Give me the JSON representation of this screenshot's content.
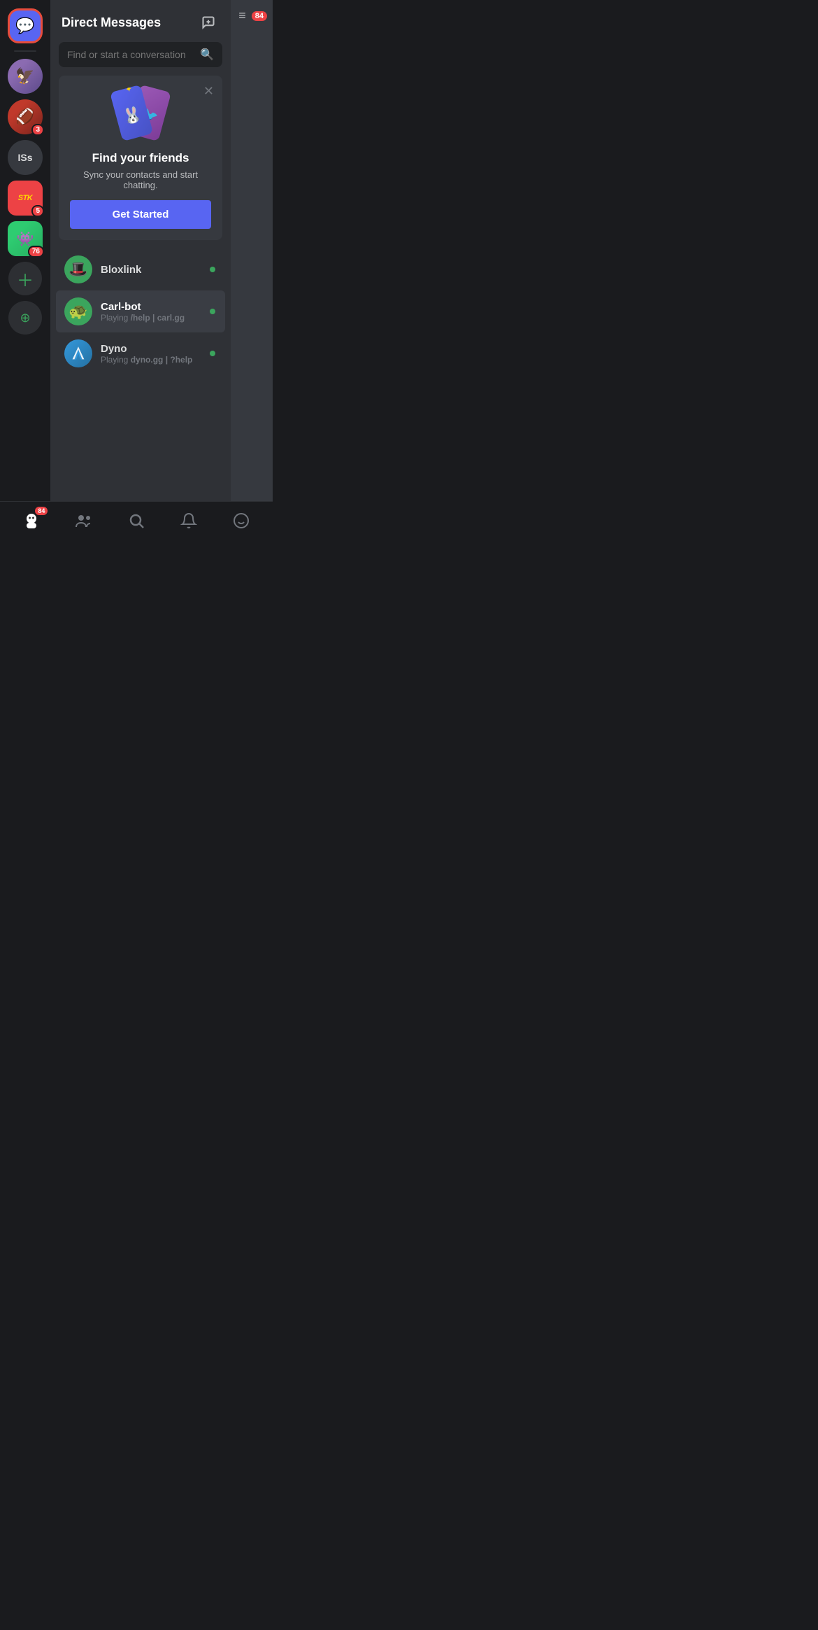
{
  "header": {
    "title": "Direct Messages",
    "new_dm_icon": "➕"
  },
  "search": {
    "placeholder": "Find or start a conversation"
  },
  "find_friends": {
    "title": "Find your friends",
    "subtitle": "Sync your contacts and start chatting.",
    "button_label": "Get Started"
  },
  "dm_list": [
    {
      "id": "bloxlink",
      "name": "Bloxlink",
      "status": "",
      "avatar_emoji": "🎩",
      "online": true,
      "active": false
    },
    {
      "id": "carl-bot",
      "name": "Carl-bot",
      "status_prefix": "Playing ",
      "status_bold": "/help | carl.gg",
      "avatar_emoji": "🐢",
      "online": true,
      "active": true
    },
    {
      "id": "dyno",
      "name": "Dyno",
      "status_prefix": "Playing ",
      "status_bold": "dyno.gg | ?help",
      "avatar_emoji": "◈",
      "online": true,
      "active": false
    }
  ],
  "sidebar": {
    "dm_icon": "💬",
    "items": [
      {
        "id": "bird-server",
        "emoji": "🦅",
        "type": "avatar",
        "badge": null
      },
      {
        "id": "warrior-server",
        "emoji": "🏈",
        "type": "avatar",
        "badge": "3"
      },
      {
        "id": "iss-server",
        "text": "ISs",
        "type": "text",
        "badge": null
      },
      {
        "id": "stk-server",
        "text": "STK",
        "type": "stk",
        "badge": "5"
      },
      {
        "id": "alien-server",
        "emoji": "👾",
        "type": "avatar",
        "badge": "76"
      }
    ]
  },
  "right_panel": {
    "badge": "84"
  },
  "bottom_nav": {
    "items": [
      {
        "id": "home",
        "icon": "👤",
        "badge": "84",
        "active": true
      },
      {
        "id": "friends",
        "icon": "👥",
        "badge": null,
        "active": false
      },
      {
        "id": "search",
        "icon": "🔍",
        "badge": null,
        "active": false
      },
      {
        "id": "bell",
        "icon": "🔔",
        "badge": null,
        "active": false
      },
      {
        "id": "emoji",
        "icon": "😊",
        "badge": null,
        "active": false
      }
    ]
  }
}
